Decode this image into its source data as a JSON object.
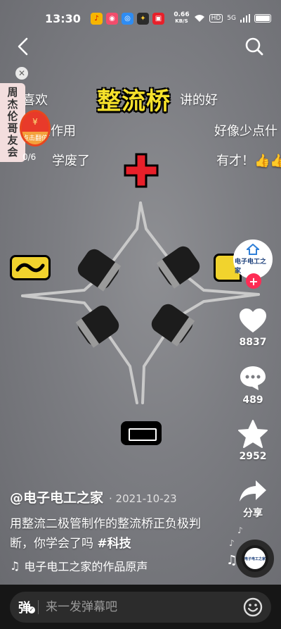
{
  "status_bar": {
    "time": "13:30",
    "net_speed": "0.66",
    "net_unit": "KB/S",
    "hd": "HD",
    "signal": "5G"
  },
  "video": {
    "title_overlay": "整流桥",
    "danmaku": [
      "喜欢",
      "讲的好",
      "么作用",
      "好像少点什",
      "学废了",
      "有才！👍👍"
    ],
    "redpack_label": "点击翻倍",
    "redpack_count": "0/6"
  },
  "side_panel": {
    "label": "周杰伦哥友会"
  },
  "author": {
    "avatar_name": "电子电工之家",
    "handle": "@电子电工之家",
    "date": "· 2021-10-23"
  },
  "actions": {
    "likes": "8837",
    "comments": "489",
    "favorites": "2952",
    "share_label": "分享"
  },
  "post": {
    "description": "用整流二极管制作的整流桥正负极判断，你学会了吗",
    "hashtag": "#科技",
    "music": "电子电工之家的作品原声"
  },
  "bottom": {
    "danmaku_toggle": "弹",
    "input_placeholder": "来一发弹幕吧"
  },
  "colors": {
    "like": "#ffffff",
    "follow": "#fe2c55",
    "title_yellow": "#f5e12b",
    "plus_red": "#e8202a"
  }
}
